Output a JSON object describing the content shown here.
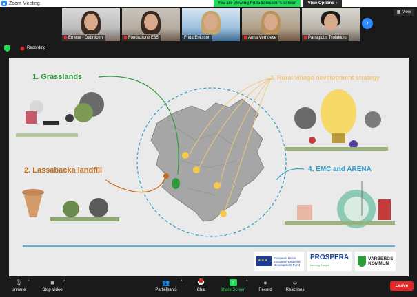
{
  "window": {
    "title": "Zoom Meeting",
    "share_banner": "You are viewing Frida Eriksson's screen",
    "view_options": "View Options",
    "view_button": "View"
  },
  "participants": [
    {
      "name": "Emese - Debreceni",
      "muted": true
    },
    {
      "name": "Fondazione E35",
      "muted": true
    },
    {
      "name": "Frida Eriksson",
      "muted": false
    },
    {
      "name": "Anna Verhoeve",
      "muted": true
    },
    {
      "name": "Panagiotis Tsolakidis",
      "muted": true
    }
  ],
  "status": {
    "recording": "Recording"
  },
  "slide": {
    "label1": "1. Grasslands",
    "label2": "2. Lassabacka landfill",
    "label3": "3. Rural village development strategy",
    "label4": "4. EMC and ARENA",
    "eu_text": "European Union European Regional Development Fund",
    "prospera": "PROSPERA",
    "prospera_sub": "Interreg Europe",
    "varberg_line1": "VARBERGS",
    "varberg_line2": "KOMMUN"
  },
  "toolbar": {
    "unmute": "Unmute",
    "stop_video": "Stop Video",
    "participants": "Participants",
    "participants_count": "16",
    "chat": "Chat",
    "chat_badge": "1",
    "share_screen": "Share Screen",
    "record": "Record",
    "reactions": "Reactions",
    "leave": "Leave"
  },
  "colors": {
    "zoom_blue": "#2d8cff",
    "share_green": "#23d959",
    "leave_red": "#e02828",
    "grasslands_green": "#2f9a3a",
    "landfill_orange": "#c56a12",
    "rural_yellow": "#f2c77a",
    "emc_blue": "#2a9fc9"
  }
}
